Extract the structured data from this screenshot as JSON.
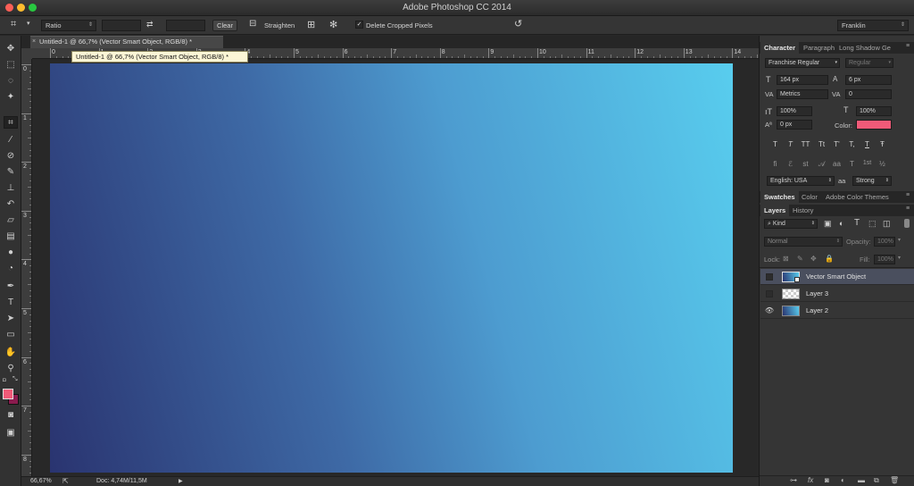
{
  "window": {
    "title": "Adobe Photoshop CC 2014"
  },
  "options_bar": {
    "ratio_select": "Ratio",
    "clear_label": "Clear",
    "straighten_label": "Straighten",
    "delete_cropped_label": "Delete Cropped Pixels",
    "delete_cropped_checked": true,
    "workspace": "Franklin"
  },
  "document": {
    "tab_title": "Untitled-1 @ 66,7% (Vector Smart Object, RGB/8) *",
    "tooltip": "Untitled-1 @ 66,7% (Vector Smart Object, RGB/8) *",
    "ruler_top": [
      "0",
      "1",
      "2",
      "3",
      "4",
      "5",
      "6",
      "7",
      "8",
      "9",
      "10",
      "11",
      "12",
      "13",
      "14"
    ],
    "ruler_left": [
      "0",
      "1",
      "2",
      "3",
      "4",
      "5",
      "6",
      "7",
      "8"
    ],
    "gradient_colors": [
      "#2a3470",
      "#3e6aa6",
      "#4d9cd0",
      "#58cdee"
    ]
  },
  "status": {
    "zoom": "66,67%",
    "doc_info": "Doc: 4,74M/11,5M"
  },
  "character": {
    "tabs": [
      "Character",
      "Paragraph",
      "Long Shadow Ge"
    ],
    "font_family": "Franchise Regular",
    "font_style": "Regular",
    "font_size": "164 px",
    "leading": "6 px",
    "kerning": "Metrics",
    "tracking": "0",
    "vertical_scale": "100%",
    "horizontal_scale": "100%",
    "baseline_shift": "0 px",
    "color_label": "Color:",
    "color_value": "#f05a78",
    "style_glyphs": [
      "T",
      "T",
      "TT",
      "Tt",
      "T'",
      "T,",
      "T",
      "Ŧ"
    ],
    "opentype_glyphs": [
      "fi",
      "ℰ",
      "st",
      "𝒜",
      "aa",
      "T",
      "1st",
      "½"
    ],
    "language": "English: USA",
    "aa_icon": "aa",
    "antialias": "Strong"
  },
  "swatches_tabs": [
    "Swatches",
    "Color",
    "Adobe Color Themes"
  ],
  "layers": {
    "tabs": [
      "Layers",
      "History"
    ],
    "filter": "Kind",
    "blend_mode": "Normal",
    "opacity_label": "Opacity:",
    "opacity": "100%",
    "lock_label": "Lock:",
    "fill_label": "Fill:",
    "fill": "100%",
    "items": [
      {
        "name": "Vector Smart Object",
        "visible": false,
        "selected": true
      },
      {
        "name": "Layer 3",
        "visible": false,
        "selected": false
      },
      {
        "name": "Layer 2",
        "visible": true,
        "selected": false
      }
    ]
  },
  "colors": {
    "foreground": "#f05a78",
    "background": "#8a1b4e",
    "panel": "#353535",
    "selected_layer": "#4a4f5e"
  },
  "icons": {
    "tools": [
      "move-icon",
      "marquee-icon",
      "lasso-icon",
      "magic-wand-icon",
      "crop-icon",
      "eyedropper-icon",
      "healing-brush-icon",
      "brush-icon",
      "clone-stamp-icon",
      "history-brush-icon",
      "eraser-icon",
      "gradient-icon",
      "blur-icon",
      "dodge-icon",
      "pen-icon",
      "type-icon",
      "path-selection-icon",
      "rectangle-icon",
      "hand-icon",
      "zoom-icon"
    ]
  }
}
